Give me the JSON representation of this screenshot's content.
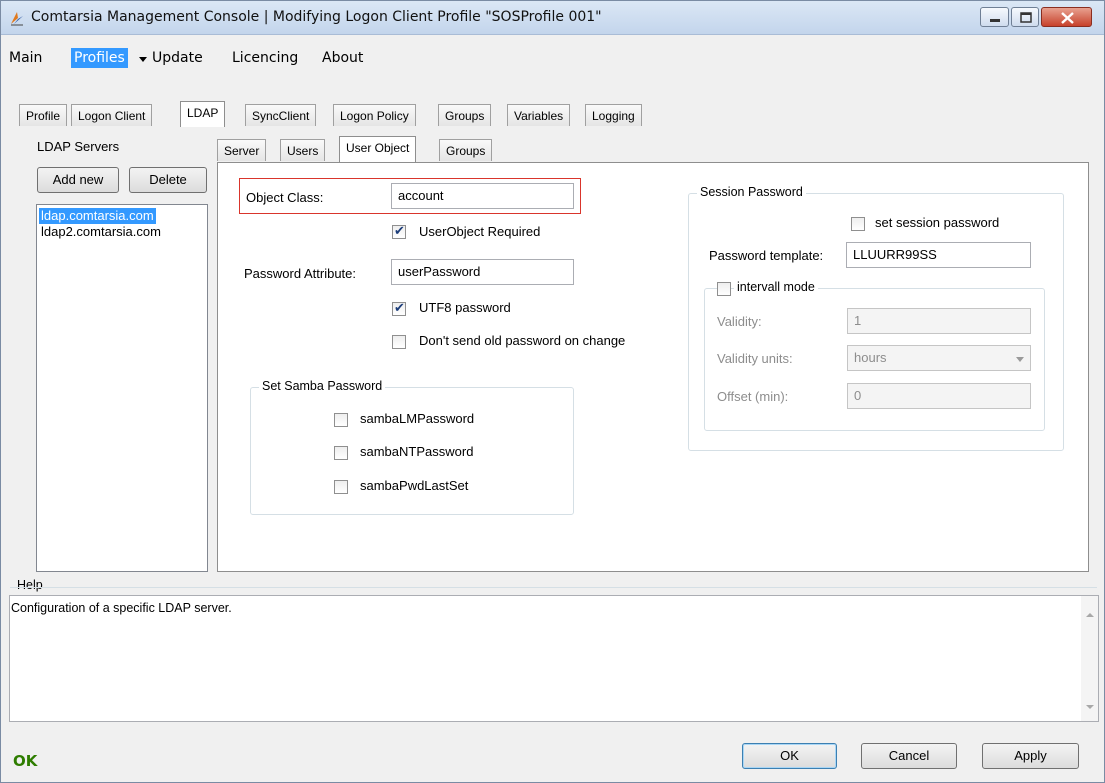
{
  "window": {
    "title": "Comtarsia Management Console | Modifying Logon Client Profile \"SOSProfile 001\"",
    "icons": {
      "app": "comtarsia-app-icon",
      "minimize": "minimize-icon",
      "maximize": "maximize-icon",
      "close": "close-icon"
    }
  },
  "menu": {
    "items": [
      "Main",
      "Profiles",
      "Update",
      "Licencing",
      "About"
    ],
    "selected": "Profiles"
  },
  "top_tabs": [
    "Profile",
    "Logon Client",
    "LDAP",
    "SyncClient",
    "Logon Policy",
    "Groups",
    "Variables",
    "Logging"
  ],
  "top_tabs_active": "LDAP",
  "ldap_servers": {
    "label": "LDAP Servers",
    "add_label": "Add new",
    "delete_label": "Delete",
    "items": [
      "ldap.comtarsia.com",
      "ldap2.comtarsia.com"
    ],
    "selected": "ldap.comtarsia.com"
  },
  "sub_tabs": [
    "Server",
    "Users",
    "User Object",
    "Groups"
  ],
  "sub_tabs_active": "User Object",
  "user_object": {
    "object_class_label": "Object Class:",
    "object_class_value": "account",
    "userobject_required_label": "UserObject Required",
    "userobject_required_checked": true,
    "password_attribute_label": "Password Attribute:",
    "password_attribute_value": "userPassword",
    "utf8_label": "UTF8 password",
    "utf8_checked": true,
    "dont_send_old_label": "Don't send old password on change",
    "dont_send_old_checked": false
  },
  "samba": {
    "legend": "Set Samba Password",
    "options": [
      {
        "label": "sambaLMPassword",
        "checked": false
      },
      {
        "label": "sambaNTPassword",
        "checked": false
      },
      {
        "label": "sambaPwdLastSet",
        "checked": false
      }
    ]
  },
  "session_password": {
    "legend": "Session Password",
    "set_label": "set session password",
    "set_checked": false,
    "template_label": "Password template:",
    "template_value": "LLUURR99SS",
    "interval": {
      "legend": "intervall mode",
      "checked": false,
      "validity_label": "Validity:",
      "validity_value": "1",
      "units_label": "Validity units:",
      "units_value": "hours",
      "offset_label": "Offset (min):",
      "offset_value": "0"
    }
  },
  "help": {
    "label": "Help",
    "text": "Configuration of a specific LDAP server."
  },
  "footer": {
    "status": "OK",
    "ok_label": "OK",
    "cancel_label": "Cancel",
    "apply_label": "Apply"
  },
  "colors": {
    "selection": "#3399ff",
    "highlight_border": "#d9352c",
    "status_ok": "#2e7d00",
    "close_button": "#c7412b"
  }
}
